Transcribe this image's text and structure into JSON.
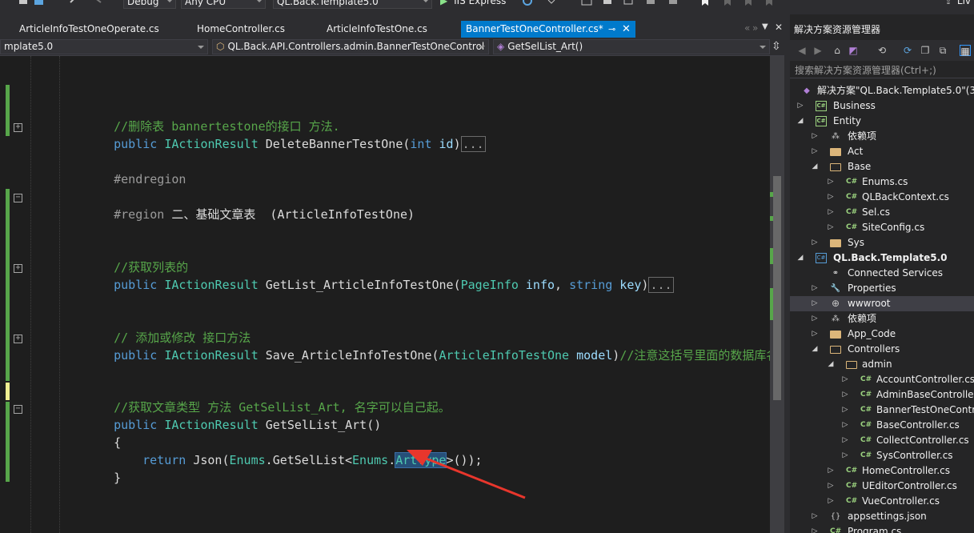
{
  "toolbar": {
    "config": "Debug",
    "platform": "Any CPU",
    "startup_project": "QL.Back.Template5.0",
    "run_target": "IIS Express",
    "live_share": "Liv"
  },
  "tabs": [
    {
      "label": "ArticleInfoTestOneOperate.cs"
    },
    {
      "label": "HomeController.cs"
    },
    {
      "label": "ArticleInfoTestOne.cs"
    },
    {
      "label": "BannerTestOneController.cs*"
    }
  ],
  "navbar": {
    "project": "mplate5.0",
    "type": "QL.Back.API.Controllers.admin.BannerTestOneControl",
    "member": "GetSelList_Art()"
  },
  "code": {
    "l1_comment": "//删除表 bannertestone的接口 方法.",
    "l2_public": "public",
    "l2_type": "IActionResult",
    "l2_method": " DeleteBannerTestOne(",
    "l2_ptype": "int",
    "l2_pname": " id",
    "l2_close": ")",
    "collapsed": "...",
    "l3_endregion": "#endregion",
    "l4_region": "#region ",
    "l4_title": "二、基础文章表  (ArticleInfoTestOne)",
    "l5_comment": "//获取列表的",
    "l6_method": " GetList_ArticleInfoTestOne(",
    "l6_t1": "PageInfo",
    "l6_p1": " info",
    "l6_comma": ", ",
    "l6_t2": "string",
    "l6_p2": " key",
    "l7_comment": "// 添加或修改 接口方法",
    "l8_method": " Save_ArticleInfoTestOne(",
    "l8_t1": "ArticleInfoTestOne",
    "l8_p1": " model",
    "l8_tail_comment": "//注意这括号里面的数据库名",
    "l9_comment": "//获取文章类型 方法 GetSelList_Art, 名字可以自己起。",
    "l10_method": " GetSelList_Art()",
    "brace_open": "{",
    "l12_return": "return",
    "l12_json": " Json(",
    "l12_enums1": "Enums",
    "l12_dot": ".",
    "l12_getsel": "GetSelList<",
    "l12_enums2": "Enums",
    "l12_arttype": "ArtType",
    "l12_tail": ">());",
    "brace_close": "}"
  },
  "solution_explorer": {
    "title": "解决方案资源管理器",
    "search_placeholder": "搜索解决方案资源管理器(Ctrl+;)",
    "items": [
      {
        "label": "解决方案\"QL.Back.Template5.0\"(3"
      },
      {
        "label": "Business"
      },
      {
        "label": "Entity"
      },
      {
        "label": "依赖项"
      },
      {
        "label": "Act"
      },
      {
        "label": "Base"
      },
      {
        "label": "Enums.cs"
      },
      {
        "label": "QLBackContext.cs"
      },
      {
        "label": "Sel.cs"
      },
      {
        "label": "SiteConfig.cs"
      },
      {
        "label": "Sys"
      },
      {
        "label": "QL.Back.Template5.0"
      },
      {
        "label": "Connected Services"
      },
      {
        "label": "Properties"
      },
      {
        "label": "wwwroot"
      },
      {
        "label": "依赖项"
      },
      {
        "label": "App_Code"
      },
      {
        "label": "Controllers"
      },
      {
        "label": "admin"
      },
      {
        "label": "AccountController.cs"
      },
      {
        "label": "AdminBaseController"
      },
      {
        "label": "BannerTestOneContr"
      },
      {
        "label": "BaseController.cs"
      },
      {
        "label": "CollectController.cs"
      },
      {
        "label": "SysController.cs"
      },
      {
        "label": "HomeController.cs"
      },
      {
        "label": "UEditorController.cs"
      },
      {
        "label": "VueController.cs"
      },
      {
        "label": "appsettings.json"
      },
      {
        "label": "Program.cs"
      }
    ]
  },
  "icons": {
    "cs": "C#",
    "proj": "C#",
    "pin": "⊸",
    "close": "✕",
    "expand_collapsed": "▷",
    "expand_open": "◢"
  },
  "colors": {
    "accent": "#007acc",
    "arrow": "#e8362c",
    "comment": "#57a64a",
    "keyword": "#569cd6",
    "type": "#4ec9b0"
  }
}
